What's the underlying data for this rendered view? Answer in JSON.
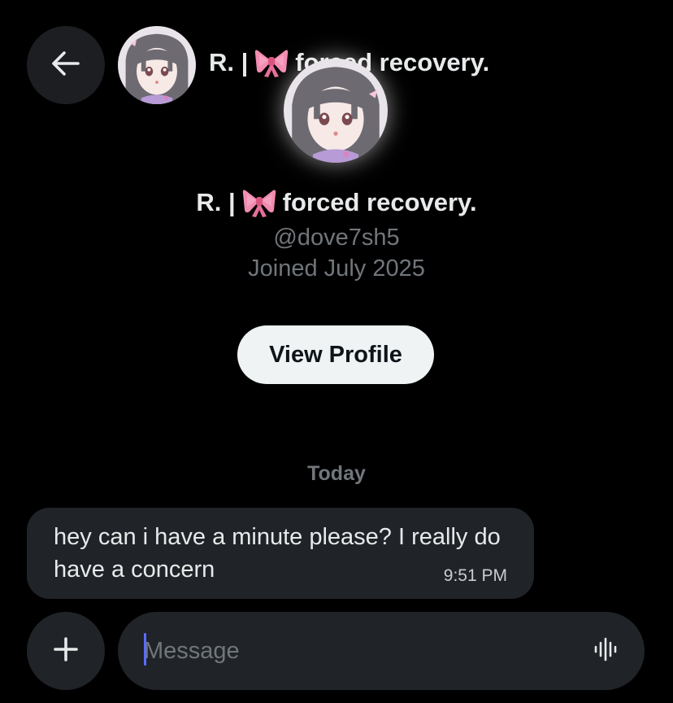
{
  "header": {
    "name_prefix": "R. |",
    "name_emoji": "ribbon-emoji",
    "name_suffix": "forced recovery.",
    "back_icon": "arrow-left-icon"
  },
  "profile": {
    "name_prefix": "R. |",
    "name_suffix": "forced recovery.",
    "handle": "@dove7sh5",
    "joined": "Joined July 2025",
    "view_profile_label": "View Profile"
  },
  "conversation": {
    "day_label": "Today",
    "messages": [
      {
        "text": "hey can i have a minute please? I really do have a concern",
        "time": "9:51 PM"
      }
    ]
  },
  "composer": {
    "placeholder": "Message",
    "value": "",
    "add_icon": "plus-icon",
    "voice_icon": "voice-waveform-icon"
  },
  "colors": {
    "background": "#000000",
    "bubble": "#202327",
    "secondary_text": "#71767b",
    "primary_text": "#e7e9ea",
    "button_bg": "#eff3f4",
    "caret": "#5b6cff"
  }
}
